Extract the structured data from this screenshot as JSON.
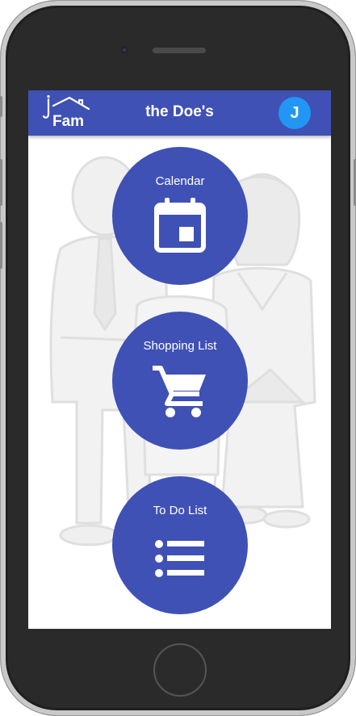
{
  "app": {
    "logo_text": "iFam",
    "title": "the Doe's",
    "avatar_initial": "J"
  },
  "tiles": [
    {
      "label": "Calendar",
      "icon": "calendar-icon"
    },
    {
      "label": "Shopping List",
      "icon": "cart-icon"
    },
    {
      "label": "To Do List",
      "icon": "list-icon"
    }
  ],
  "colors": {
    "primary": "#3f51b5",
    "avatar": "#2196f3",
    "phone_body": "#2a2a2a"
  }
}
